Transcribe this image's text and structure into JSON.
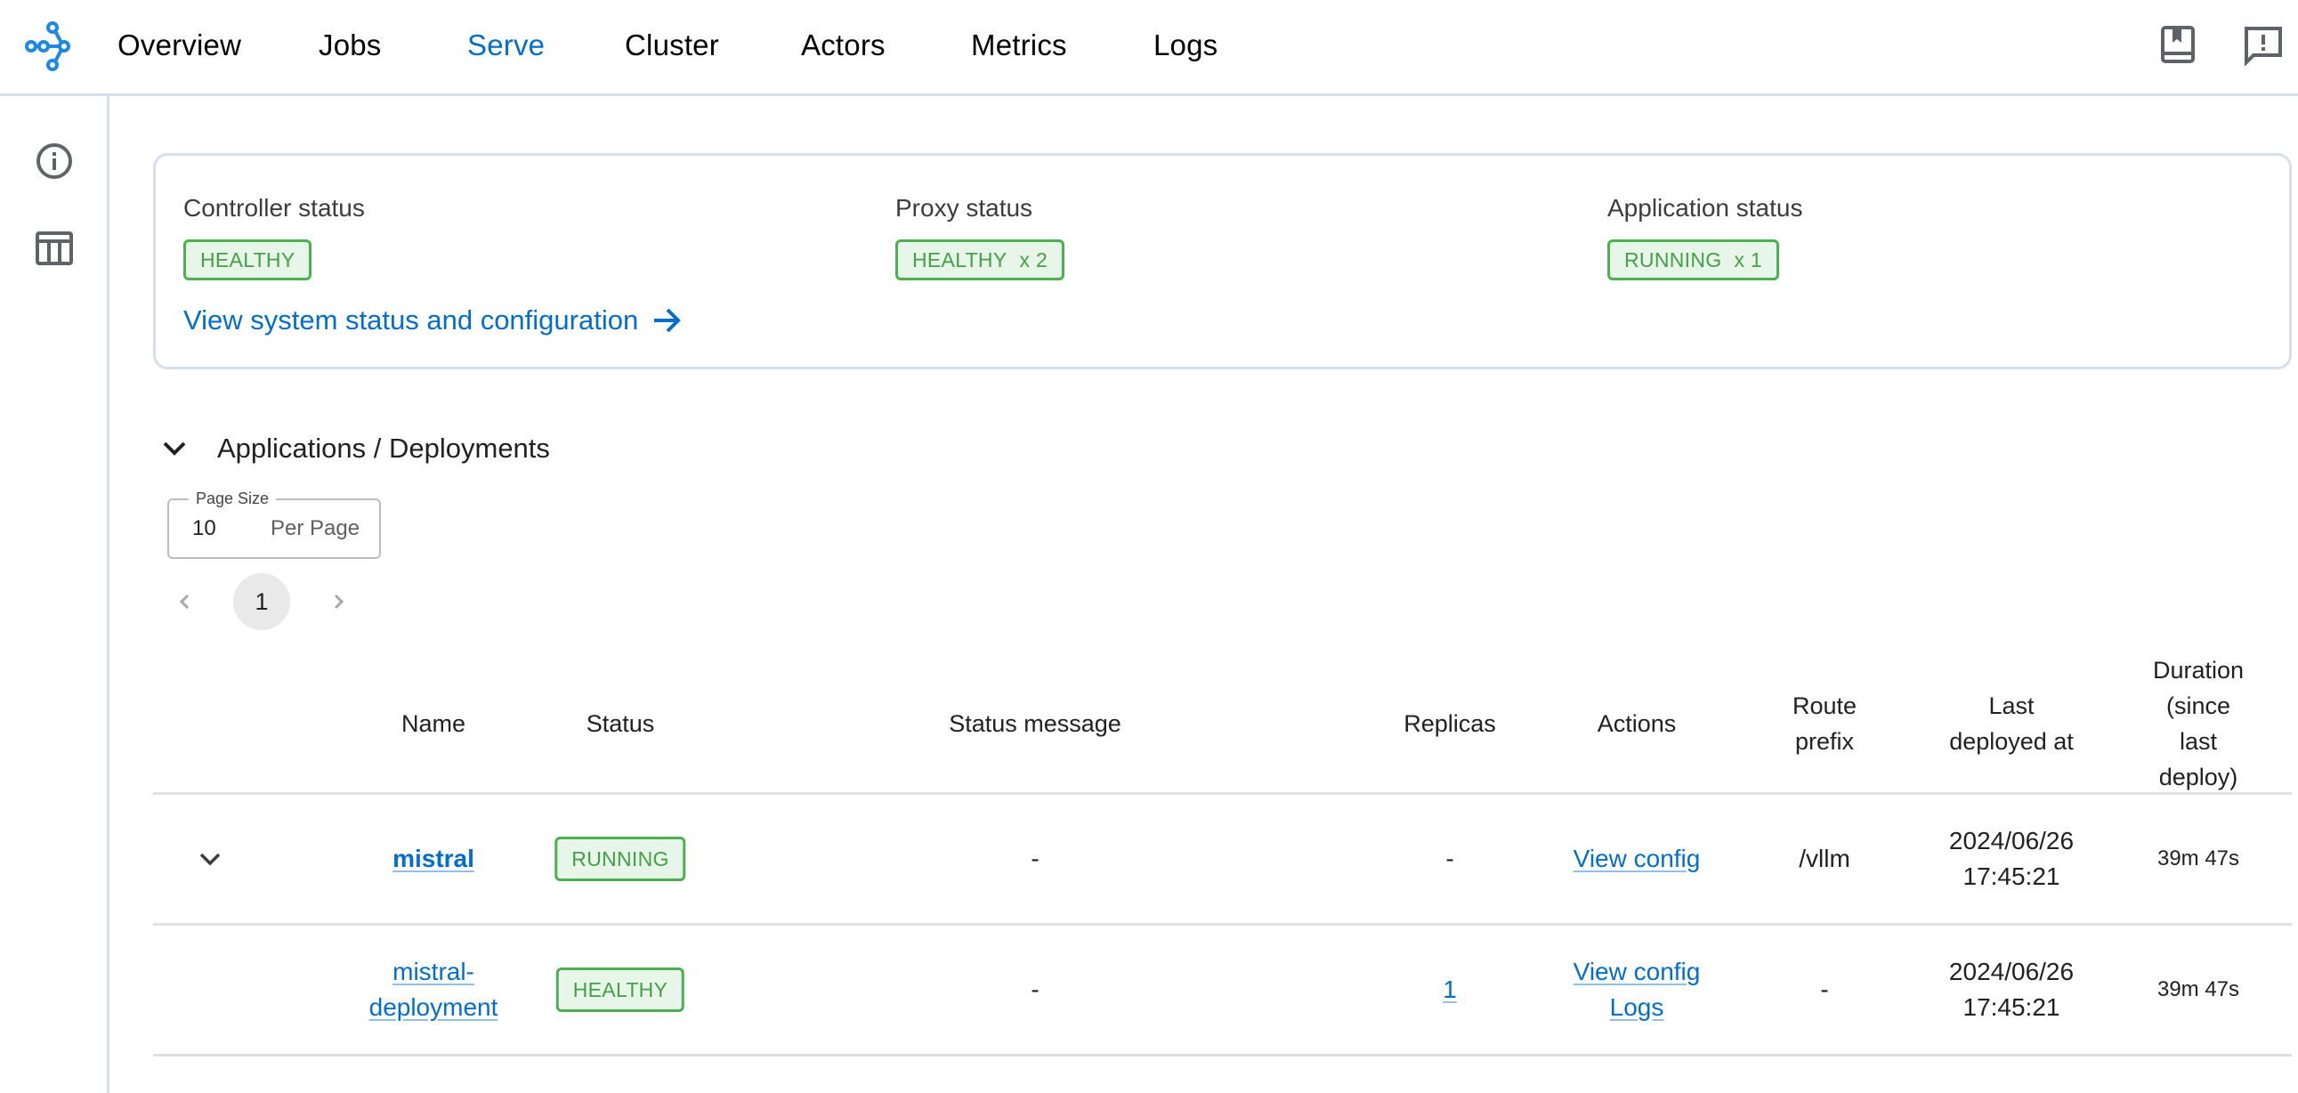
{
  "nav": {
    "items": [
      {
        "label": "Overview",
        "active": false
      },
      {
        "label": "Jobs",
        "active": false
      },
      {
        "label": "Serve",
        "active": true
      },
      {
        "label": "Cluster",
        "active": false
      },
      {
        "label": "Actors",
        "active": false
      },
      {
        "label": "Metrics",
        "active": false
      },
      {
        "label": "Logs",
        "active": false
      }
    ],
    "right_icons": [
      "docs-book-icon",
      "feedback-icon"
    ]
  },
  "sidebar": {
    "icons": [
      "info-icon",
      "table-icon"
    ]
  },
  "status_card": {
    "controller": {
      "label": "Controller status",
      "badge": "HEALTHY",
      "count": ""
    },
    "proxy": {
      "label": "Proxy status",
      "badge": "HEALTHY",
      "count": "x 2"
    },
    "application": {
      "label": "Application status",
      "badge": "RUNNING",
      "count": "x 1"
    },
    "link": "View system status and configuration"
  },
  "section": {
    "title": "Applications / Deployments",
    "page_size_label": "Page Size",
    "page_size_value": "10",
    "page_size_suffix": "Per Page",
    "current_page": "1"
  },
  "colors": {
    "accent": "#036dcf",
    "healthy_border": "#4caf50",
    "healthy_bg": "#e8f5e9",
    "healthy_text": "#43a047"
  },
  "table": {
    "headers": {
      "name": "Name",
      "status": "Status",
      "status_message": "Status message",
      "replicas": "Replicas",
      "actions": "Actions",
      "route_prefix_1": "Route",
      "route_prefix_2": "prefix",
      "last_deployed_1": "Last",
      "last_deployed_2": "deployed at",
      "duration_1": "Duration",
      "duration_2": "(since last",
      "duration_3": "deploy)"
    },
    "rows": [
      {
        "name": "mistral",
        "status": "RUNNING",
        "status_message": "-",
        "replicas": "-",
        "actions": [
          "View config"
        ],
        "route_prefix": "/vllm",
        "last_deployed_date": "2024/06/26",
        "last_deployed_time": "17:45:21",
        "duration": "39m 47s"
      },
      {
        "name_1": "mistral-",
        "name_2": "deployment",
        "status": "HEALTHY",
        "status_message": "-",
        "replicas": "1",
        "actions": [
          "View config",
          "Logs"
        ],
        "route_prefix": "-",
        "last_deployed_date": "2024/06/26",
        "last_deployed_time": "17:45:21",
        "duration": "39m 47s"
      }
    ]
  }
}
